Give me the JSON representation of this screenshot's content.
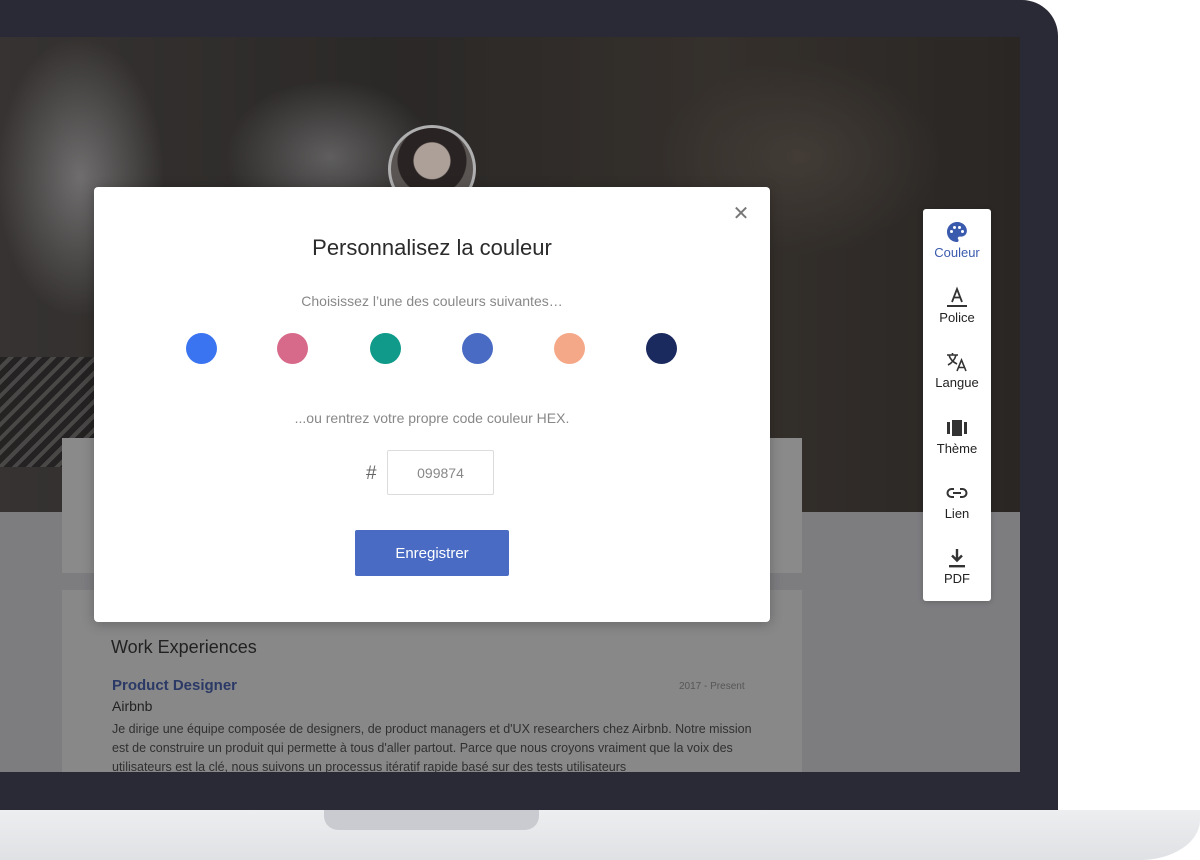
{
  "background_profile": {
    "section_title": "Work Experiences",
    "job": {
      "title": "Product Designer",
      "company": "Airbnb",
      "date": "2017 - Present",
      "description": "Je dirige une équipe composée de designers, de product managers et d'UX researchers chez Airbnb. Notre mission est de construire un produit qui permette à tous d'aller partout. Parce que nous croyons vraiment que la voix des utilisateurs est la clé, nous suivons un processus itératif rapide basé sur des tests utilisateurs"
    }
  },
  "modal": {
    "title": "Personnalisez la couleur",
    "subtitle": "Choisissez l’une des couleurs suivantes…",
    "swatches": [
      {
        "name": "blue",
        "color": "#3a74f0"
      },
      {
        "name": "pink",
        "color": "#d76a8a"
      },
      {
        "name": "teal",
        "color": "#109a8a"
      },
      {
        "name": "indigo",
        "color": "#4a6bc4"
      },
      {
        "name": "peach",
        "color": "#f5a888"
      },
      {
        "name": "navy",
        "color": "#1a2a5e"
      }
    ],
    "hex_hint": "...ou rentrez votre propre code couleur HEX.",
    "hash_symbol": "#",
    "hex_value": "099874",
    "save_label": "Enregistrer"
  },
  "toolbar": {
    "accent_color": "#3a5aad",
    "items": [
      {
        "label": "Couleur",
        "icon": "palette-icon"
      },
      {
        "label": "Police",
        "icon": "font-icon"
      },
      {
        "label": "Langue",
        "icon": "translate-icon"
      },
      {
        "label": "Thème",
        "icon": "theme-icon"
      },
      {
        "label": "Lien",
        "icon": "link-icon"
      },
      {
        "label": "PDF",
        "icon": "download-icon"
      }
    ]
  }
}
